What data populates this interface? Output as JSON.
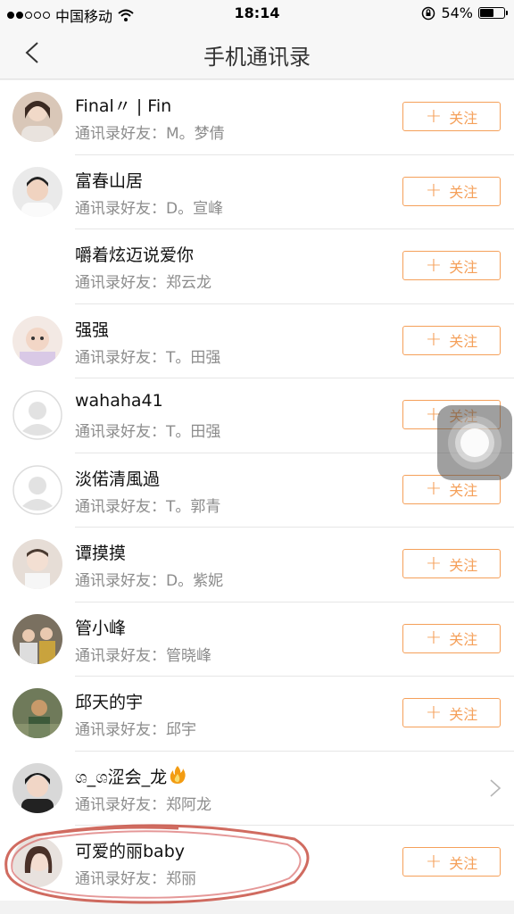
{
  "status_bar": {
    "carrier": "中国移动",
    "time": "18:14",
    "battery": "54%",
    "battery_level": 0.54
  },
  "navbar": {
    "title": "手机通讯录",
    "back_icon": "chevron-left-icon"
  },
  "follow_label": "关注",
  "contacts": [
    {
      "name": "Final〃 | Fin",
      "sub": "通讯录好友：M。梦倩",
      "action": "follow"
    },
    {
      "name": "富春山居",
      "sub": "通讯录好友：D。宣峰",
      "action": "follow"
    },
    {
      "name": "嚼着炫迈说爱你",
      "sub": "通讯录好友：郑云龙",
      "action": "follow"
    },
    {
      "name": "强强",
      "sub": "通讯录好友：T。田强",
      "action": "follow"
    },
    {
      "name": "wahaha41",
      "sub": "通讯录好友：T。田强",
      "action": "follow"
    },
    {
      "name": "淡偌清風過",
      "sub": "通讯录好友：T。郭青",
      "action": "follow"
    },
    {
      "name": "谭摸摸",
      "sub": "通讯录好友：D。紫妮",
      "action": "follow"
    },
    {
      "name": "管小峰",
      "sub": "通讯录好友：管晓峰",
      "action": "follow"
    },
    {
      "name": "邱天的宇",
      "sub": "通讯录好友：邱宇",
      "action": "follow"
    },
    {
      "name": "ශ_ශ涩会_龙",
      "sub": "通讯录好友：郑阿龙",
      "action": "chevron"
    },
    {
      "name": "可爱的丽baby",
      "sub": "通讯录好友：郑丽",
      "action": "follow"
    }
  ],
  "colors": {
    "accent": "#f5a05a",
    "highlight_scribble": "#c0392b"
  }
}
